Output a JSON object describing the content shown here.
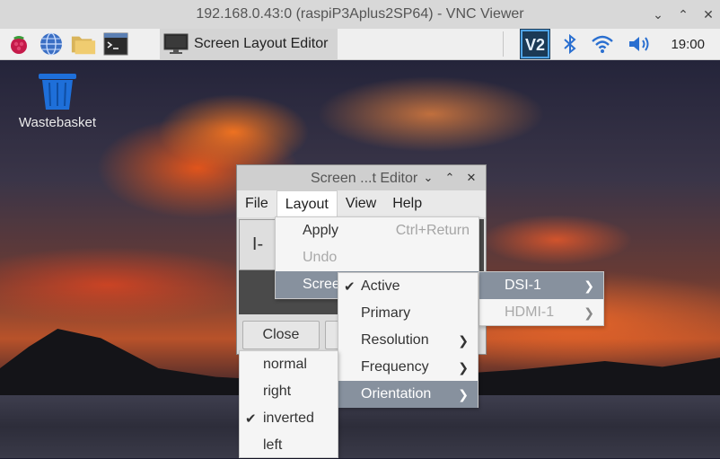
{
  "vnc": {
    "title": "192.168.0.43:0 (raspiP3Aplus2SP64) - VNC Viewer",
    "controls": [
      "chevron-down",
      "chevron-up",
      "close"
    ]
  },
  "taskbar": {
    "launchers": [
      "raspberry-menu-icon",
      "web-browser-icon",
      "file-manager-icon",
      "terminal-icon"
    ],
    "task_label": "Screen Layout Editor",
    "tray": [
      "vnc-icon",
      "bluetooth-icon",
      "wifi-icon",
      "volume-icon"
    ],
    "clock": "19:00"
  },
  "desktop": {
    "wastebasket_label": "Wastebasket"
  },
  "window": {
    "title": "Screen ...t Editor",
    "menu": [
      "File",
      "Layout",
      "View",
      "Help"
    ],
    "screen_label": "I-",
    "close_label": "Close",
    "colors": {
      "menu_highlight": "#87919e"
    }
  },
  "layout_menu": {
    "apply": "Apply",
    "apply_shortcut": "Ctrl+Return",
    "undo": "Undo",
    "screens": "Scree"
  },
  "screens_submenu": [
    "DSI-1",
    "HDMI-1"
  ],
  "dsi_submenu": {
    "active": "Active",
    "primary": "Primary",
    "resolution": "Resolution",
    "frequency": "Frequency",
    "orientation": "Orientation"
  },
  "orientation_submenu": {
    "items": [
      "normal",
      "right",
      "inverted",
      "left"
    ],
    "checked": "inverted"
  }
}
